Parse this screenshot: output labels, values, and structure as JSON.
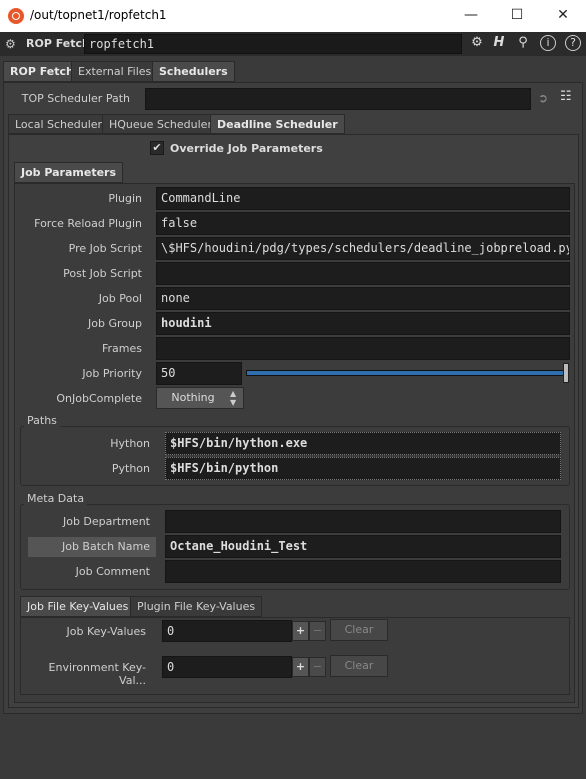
{
  "window": {
    "title": "/out/topnet1/ropfetch1"
  },
  "header": {
    "node_type": "ROP Fetch",
    "node_name": "ropfetch1"
  },
  "tabs": [
    "ROP Fetch",
    "External Files",
    "Schedulers"
  ],
  "top_scheduler": {
    "label": "TOP Scheduler Path",
    "value": ""
  },
  "sched_tabs": [
    "Local Scheduler",
    "HQueue Scheduler",
    "Deadline Scheduler"
  ],
  "override": {
    "label": "Override Job Parameters",
    "check": "✔"
  },
  "job_tab": "Job Parameters",
  "params": [
    {
      "label": "Plugin",
      "value": "CommandLine"
    },
    {
      "label": "Force Reload Plugin",
      "value": "false"
    },
    {
      "label": "Pre Job Script",
      "value": "\\$HFS/houdini/pdg/types/schedulers/deadline_jobpreload.py"
    },
    {
      "label": "Post Job Script",
      "value": ""
    },
    {
      "label": "Job Pool",
      "value": "none"
    },
    {
      "label": "Job Group",
      "value": "houdini"
    },
    {
      "label": "Frames",
      "value": ""
    }
  ],
  "priority": {
    "label": "Job Priority",
    "value": "50",
    "slider_fraction": 1.0
  },
  "onjob": {
    "label": "OnJobComplete",
    "value": "Nothing"
  },
  "paths": {
    "title": "Paths",
    "items": [
      {
        "label": "Hython",
        "value": "$HFS/bin/hython.exe"
      },
      {
        "label": "Python",
        "value": "$HFS/bin/python"
      }
    ]
  },
  "meta": {
    "title": "Meta Data",
    "items": [
      {
        "label": "Job Department",
        "value": ""
      },
      {
        "label": "Job Batch Name",
        "value": "Octane_Houdini_Test"
      },
      {
        "label": "Job Comment",
        "value": ""
      }
    ]
  },
  "kv_tabs": [
    "Job File Key-Values",
    "Plugin File Key-Values"
  ],
  "kv": [
    {
      "label": "Job Key-Values",
      "value": "0",
      "plus": "+",
      "minus": "−",
      "clear": "Clear"
    },
    {
      "label": "Environment Key-Val...",
      "value": "0",
      "plus": "+",
      "minus": "−",
      "clear": "Clear"
    }
  ],
  "colors": {
    "accent": "#2f6fb0"
  }
}
